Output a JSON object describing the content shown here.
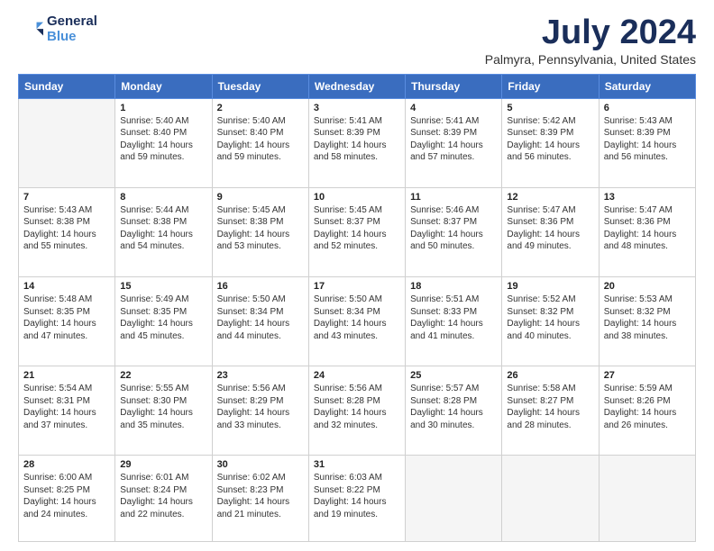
{
  "header": {
    "logo_general": "General",
    "logo_blue": "Blue",
    "month_title": "July 2024",
    "location": "Palmyra, Pennsylvania, United States"
  },
  "calendar": {
    "days_of_week": [
      "Sunday",
      "Monday",
      "Tuesday",
      "Wednesday",
      "Thursday",
      "Friday",
      "Saturday"
    ],
    "weeks": [
      [
        {
          "day": "",
          "info": ""
        },
        {
          "day": "1",
          "info": "Sunrise: 5:40 AM\nSunset: 8:40 PM\nDaylight: 14 hours\nand 59 minutes."
        },
        {
          "day": "2",
          "info": "Sunrise: 5:40 AM\nSunset: 8:40 PM\nDaylight: 14 hours\nand 59 minutes."
        },
        {
          "day": "3",
          "info": "Sunrise: 5:41 AM\nSunset: 8:39 PM\nDaylight: 14 hours\nand 58 minutes."
        },
        {
          "day": "4",
          "info": "Sunrise: 5:41 AM\nSunset: 8:39 PM\nDaylight: 14 hours\nand 57 minutes."
        },
        {
          "day": "5",
          "info": "Sunrise: 5:42 AM\nSunset: 8:39 PM\nDaylight: 14 hours\nand 56 minutes."
        },
        {
          "day": "6",
          "info": "Sunrise: 5:43 AM\nSunset: 8:39 PM\nDaylight: 14 hours\nand 56 minutes."
        }
      ],
      [
        {
          "day": "7",
          "info": "Sunrise: 5:43 AM\nSunset: 8:38 PM\nDaylight: 14 hours\nand 55 minutes."
        },
        {
          "day": "8",
          "info": "Sunrise: 5:44 AM\nSunset: 8:38 PM\nDaylight: 14 hours\nand 54 minutes."
        },
        {
          "day": "9",
          "info": "Sunrise: 5:45 AM\nSunset: 8:38 PM\nDaylight: 14 hours\nand 53 minutes."
        },
        {
          "day": "10",
          "info": "Sunrise: 5:45 AM\nSunset: 8:37 PM\nDaylight: 14 hours\nand 52 minutes."
        },
        {
          "day": "11",
          "info": "Sunrise: 5:46 AM\nSunset: 8:37 PM\nDaylight: 14 hours\nand 50 minutes."
        },
        {
          "day": "12",
          "info": "Sunrise: 5:47 AM\nSunset: 8:36 PM\nDaylight: 14 hours\nand 49 minutes."
        },
        {
          "day": "13",
          "info": "Sunrise: 5:47 AM\nSunset: 8:36 PM\nDaylight: 14 hours\nand 48 minutes."
        }
      ],
      [
        {
          "day": "14",
          "info": "Sunrise: 5:48 AM\nSunset: 8:35 PM\nDaylight: 14 hours\nand 47 minutes."
        },
        {
          "day": "15",
          "info": "Sunrise: 5:49 AM\nSunset: 8:35 PM\nDaylight: 14 hours\nand 45 minutes."
        },
        {
          "day": "16",
          "info": "Sunrise: 5:50 AM\nSunset: 8:34 PM\nDaylight: 14 hours\nand 44 minutes."
        },
        {
          "day": "17",
          "info": "Sunrise: 5:50 AM\nSunset: 8:34 PM\nDaylight: 14 hours\nand 43 minutes."
        },
        {
          "day": "18",
          "info": "Sunrise: 5:51 AM\nSunset: 8:33 PM\nDaylight: 14 hours\nand 41 minutes."
        },
        {
          "day": "19",
          "info": "Sunrise: 5:52 AM\nSunset: 8:32 PM\nDaylight: 14 hours\nand 40 minutes."
        },
        {
          "day": "20",
          "info": "Sunrise: 5:53 AM\nSunset: 8:32 PM\nDaylight: 14 hours\nand 38 minutes."
        }
      ],
      [
        {
          "day": "21",
          "info": "Sunrise: 5:54 AM\nSunset: 8:31 PM\nDaylight: 14 hours\nand 37 minutes."
        },
        {
          "day": "22",
          "info": "Sunrise: 5:55 AM\nSunset: 8:30 PM\nDaylight: 14 hours\nand 35 minutes."
        },
        {
          "day": "23",
          "info": "Sunrise: 5:56 AM\nSunset: 8:29 PM\nDaylight: 14 hours\nand 33 minutes."
        },
        {
          "day": "24",
          "info": "Sunrise: 5:56 AM\nSunset: 8:28 PM\nDaylight: 14 hours\nand 32 minutes."
        },
        {
          "day": "25",
          "info": "Sunrise: 5:57 AM\nSunset: 8:28 PM\nDaylight: 14 hours\nand 30 minutes."
        },
        {
          "day": "26",
          "info": "Sunrise: 5:58 AM\nSunset: 8:27 PM\nDaylight: 14 hours\nand 28 minutes."
        },
        {
          "day": "27",
          "info": "Sunrise: 5:59 AM\nSunset: 8:26 PM\nDaylight: 14 hours\nand 26 minutes."
        }
      ],
      [
        {
          "day": "28",
          "info": "Sunrise: 6:00 AM\nSunset: 8:25 PM\nDaylight: 14 hours\nand 24 minutes."
        },
        {
          "day": "29",
          "info": "Sunrise: 6:01 AM\nSunset: 8:24 PM\nDaylight: 14 hours\nand 22 minutes."
        },
        {
          "day": "30",
          "info": "Sunrise: 6:02 AM\nSunset: 8:23 PM\nDaylight: 14 hours\nand 21 minutes."
        },
        {
          "day": "31",
          "info": "Sunrise: 6:03 AM\nSunset: 8:22 PM\nDaylight: 14 hours\nand 19 minutes."
        },
        {
          "day": "",
          "info": ""
        },
        {
          "day": "",
          "info": ""
        },
        {
          "day": "",
          "info": ""
        }
      ]
    ]
  }
}
